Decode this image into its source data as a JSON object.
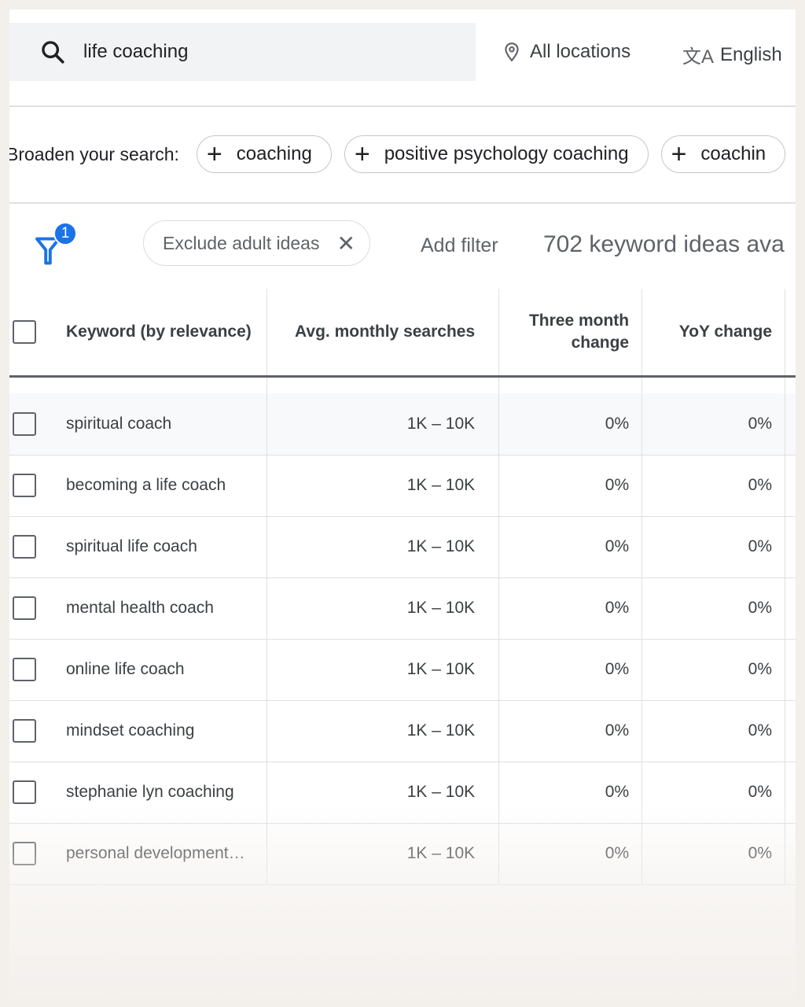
{
  "search": {
    "query": "life coaching",
    "location": "All locations",
    "language": "English"
  },
  "broaden": {
    "label": "Broaden your search:",
    "chips": [
      "coaching",
      "positive psychology coaching",
      "coachin"
    ]
  },
  "filters": {
    "badge_count": "1",
    "chip": "Exclude adult ideas",
    "add_filter": "Add filter",
    "results": "702 keyword ideas ava"
  },
  "table": {
    "headers": [
      "Keyword (by relevance)",
      "Avg. monthly searches",
      "Three month change",
      "YoY change"
    ],
    "rows": [
      [
        "spiritual coach",
        "1K – 10K",
        "0%",
        "0%"
      ],
      [
        "becoming a life coach",
        "1K – 10K",
        "0%",
        "0%"
      ],
      [
        "spiritual life coach",
        "1K – 10K",
        "0%",
        "0%"
      ],
      [
        "mental health coach",
        "1K – 10K",
        "0%",
        "0%"
      ],
      [
        "online life coach",
        "1K – 10K",
        "0%",
        "0%"
      ],
      [
        "mindset coaching",
        "1K – 10K",
        "0%",
        "0%"
      ],
      [
        "stephanie lyn coaching",
        "1K – 10K",
        "0%",
        "0%"
      ],
      [
        "personal development…",
        "1K – 10K",
        "0%",
        "0%"
      ]
    ]
  },
  "colors": {
    "accent": "#1a73e8",
    "background": "#f3efeb"
  }
}
